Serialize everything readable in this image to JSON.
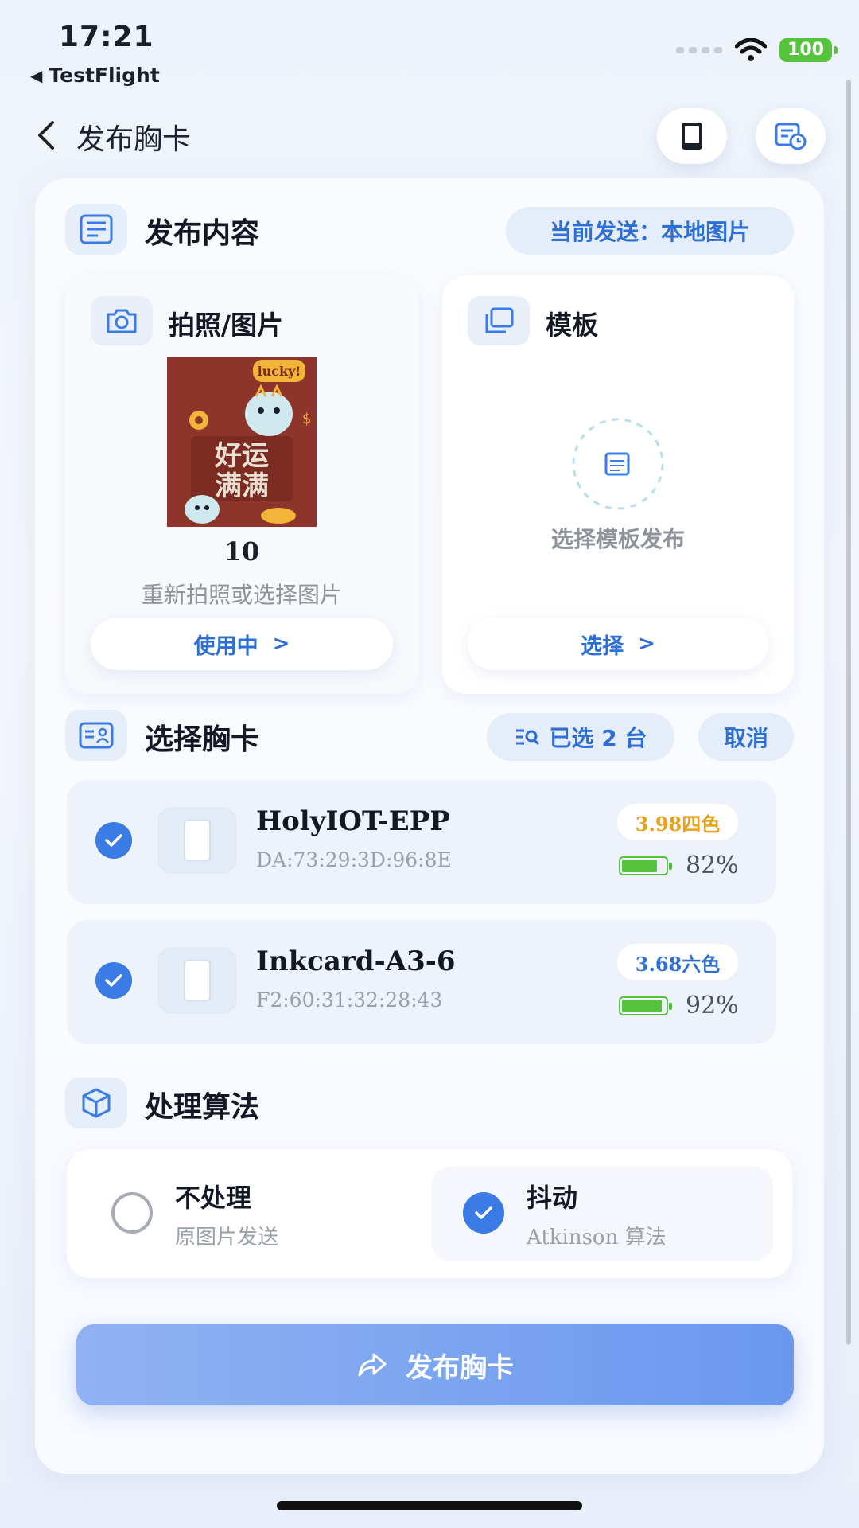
{
  "status_bar": {
    "time": "17:21",
    "back_app": "TestFlight",
    "battery": "100"
  },
  "header": {
    "title": "发布胸卡"
  },
  "publish_content": {
    "title": "发布内容",
    "current_send": "当前发送：本地图片",
    "photo_card": {
      "title": "拍照/图片",
      "image_number": "10",
      "subtitle": "重新拍照或选择图片",
      "button": "使用中"
    },
    "template_card": {
      "title": "模板",
      "placeholder": "选择模板发布",
      "button": "选择"
    }
  },
  "select_badge": {
    "title": "选择胸卡",
    "selected": "已选 2 台",
    "cancel": "取消",
    "devices": [
      {
        "name": "HolyIOT-EPP",
        "mac": "DA:73:29:3D:96:8E",
        "tag": "3.98四色",
        "tag_color": "#e8a21a",
        "battery": "82%",
        "battery_level": 0.82
      },
      {
        "name": "Inkcard-A3-6",
        "mac": "F2:60:31:32:28:43",
        "tag": "3.68六色",
        "tag_color": "#2e6fd6",
        "battery": "92%",
        "battery_level": 0.92
      }
    ]
  },
  "algorithm": {
    "title": "处理算法",
    "options": [
      {
        "title": "不处理",
        "subtitle": "原图片发送",
        "selected": false
      },
      {
        "title": "抖动",
        "subtitle": "Atkinson 算法",
        "selected": true
      }
    ]
  },
  "publish_button": "发布胸卡",
  "photo_text": {
    "badge": "lucky!",
    "line1": "好运",
    "line2": "满满",
    "dollar": "$"
  },
  "colors": {
    "accent": "#2e6fd6",
    "battery_green": "#56c33c"
  }
}
